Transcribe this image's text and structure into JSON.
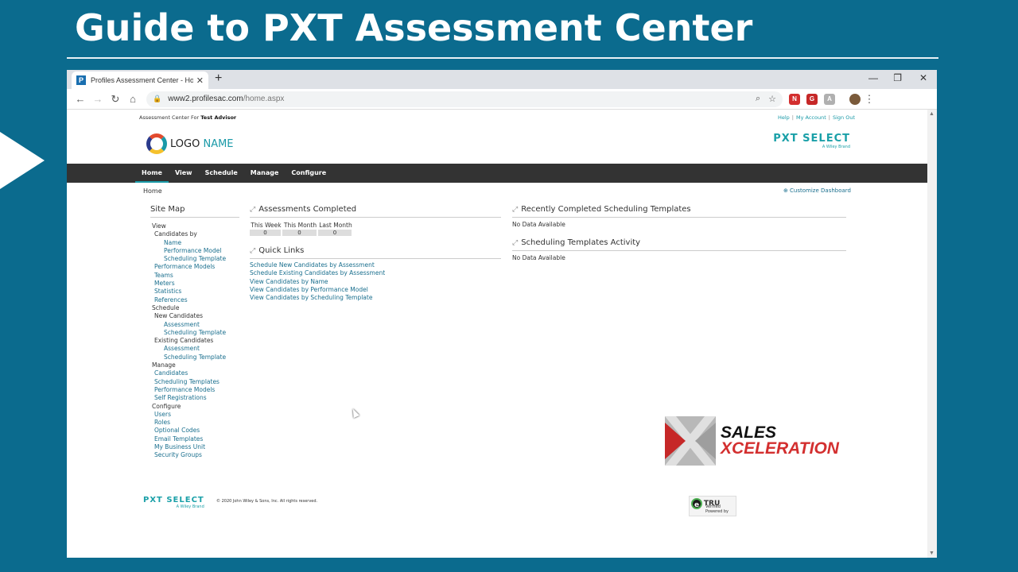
{
  "slide": {
    "title": "Guide to PXT Assessment Center"
  },
  "browser": {
    "tab_title": "Profiles Assessment Center - Hom",
    "url_host": "www2.profilesac.com",
    "url_path": "/home.aspx"
  },
  "page": {
    "assessment_for_label": "Assessment Center For",
    "assessment_for_user": "Test Advisor",
    "top_links": [
      "Help",
      "My Account",
      "Sign Out"
    ],
    "logo_word": "LOGO",
    "logo_name": "NAME",
    "brand_logo": "PXT SELECT",
    "brand_sub": "A Wiley Brand",
    "nav": [
      "Home",
      "View",
      "Schedule",
      "Manage",
      "Configure"
    ],
    "breadcrumb": "Home",
    "customize": "Customize Dashboard",
    "sitemap": {
      "title": "Site Map",
      "items": [
        {
          "label": "View",
          "level": 0
        },
        {
          "label": "Candidates by",
          "level": 1
        },
        {
          "label": "Name",
          "level": 2
        },
        {
          "label": "Performance Model",
          "level": 2
        },
        {
          "label": "Scheduling Template",
          "level": 2
        },
        {
          "label": "Performance Models",
          "level": "1link"
        },
        {
          "label": "Teams",
          "level": "1link"
        },
        {
          "label": "Meters",
          "level": "1link"
        },
        {
          "label": "Statistics",
          "level": "1link"
        },
        {
          "label": "References",
          "level": "1link"
        },
        {
          "label": "Schedule",
          "level": 0
        },
        {
          "label": "New Candidates",
          "level": 1
        },
        {
          "label": "Assessment",
          "level": 2
        },
        {
          "label": "Scheduling Template",
          "level": 2
        },
        {
          "label": "Existing Candidates",
          "level": 1
        },
        {
          "label": "Assessment",
          "level": 2
        },
        {
          "label": "Scheduling Template",
          "level": 2
        },
        {
          "label": "Manage",
          "level": 0
        },
        {
          "label": "Candidates",
          "level": "1link"
        },
        {
          "label": "Scheduling Templates",
          "level": "1link"
        },
        {
          "label": "Performance Models",
          "level": "1link"
        },
        {
          "label": "Self Registrations",
          "level": "1link"
        },
        {
          "label": "Configure",
          "level": 0
        },
        {
          "label": "Users",
          "level": "1link"
        },
        {
          "label": "Roles",
          "level": "1link"
        },
        {
          "label": "Optional Codes",
          "level": "1link"
        },
        {
          "label": "Email Templates",
          "level": "1link"
        },
        {
          "label": "My Business Unit",
          "level": "1link"
        },
        {
          "label": "Security Groups",
          "level": "1link"
        }
      ]
    },
    "assessments": {
      "title": "Assessments Completed",
      "cols": [
        {
          "label": "This Week",
          "value": "0"
        },
        {
          "label": "This Month",
          "value": "0"
        },
        {
          "label": "Last Month",
          "value": "0"
        }
      ]
    },
    "quick_links": {
      "title": "Quick Links",
      "links": [
        "Schedule New Candidates by Assessment",
        "Schedule Existing Candidates by Assessment",
        "View Candidates by Name",
        "View Candidates by Performance Model",
        "View Candidates by Scheduling Template"
      ]
    },
    "recent_templates": {
      "title": "Recently Completed Scheduling Templates",
      "body": "No Data Available"
    },
    "templates_activity": {
      "title": "Scheduling Templates Activity",
      "body": "No Data Available"
    },
    "footer": {
      "brand": "PXT SELECT",
      "brand_sub": "A Wiley Brand",
      "copyright": "© 2020 John Wiley & Sons, Inc. All rights reserved.",
      "trust_word": "TRU",
      "trust_line1": "Verified",
      "trust_line2": "Powered by"
    }
  },
  "watermark": {
    "line1": "SALES",
    "line2": "XCELERATION"
  }
}
